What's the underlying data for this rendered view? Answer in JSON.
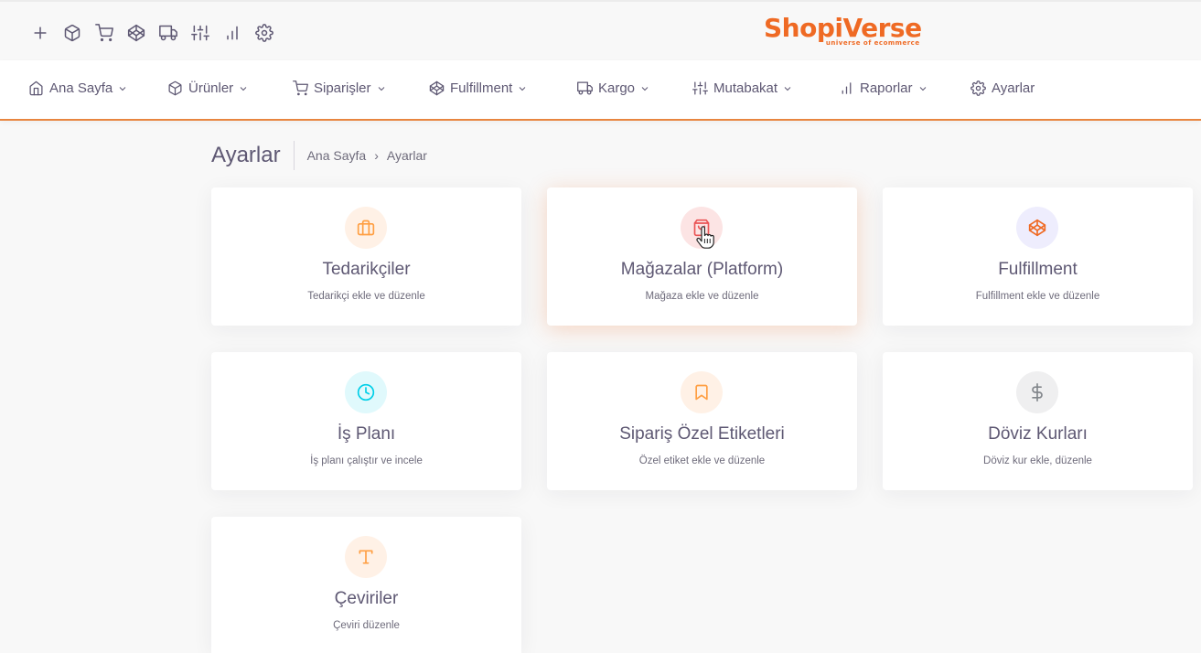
{
  "brand": {
    "name": "ShopiVerse",
    "tagline": "universe of ecommerce",
    "color": "#ef6a24"
  },
  "top_icons": [
    "plus-icon",
    "box-icon",
    "cart-icon",
    "codepen-icon",
    "truck-icon",
    "sliders-icon",
    "bar-chart-icon",
    "gear-icon"
  ],
  "nav": {
    "items": [
      {
        "label": "Ana Sayfa",
        "icon": "home-icon",
        "dropdown": true
      },
      {
        "label": "Ürünler",
        "icon": "box-icon",
        "dropdown": true
      },
      {
        "label": "Siparişler",
        "icon": "cart-icon",
        "dropdown": true
      },
      {
        "label": "Fulfillment",
        "icon": "codepen-icon",
        "dropdown": true
      },
      {
        "label": "Kargo",
        "icon": "truck-icon",
        "dropdown": true
      },
      {
        "label": "Mutabakat",
        "icon": "sliders-icon",
        "dropdown": true
      },
      {
        "label": "Raporlar",
        "icon": "bar-chart-icon",
        "dropdown": true
      },
      {
        "label": "Ayarlar",
        "icon": "gear-icon",
        "dropdown": false
      }
    ]
  },
  "page": {
    "title": "Ayarlar",
    "breadcrumb": {
      "home": "Ana Sayfa",
      "current": "Ayarlar"
    }
  },
  "cards": [
    {
      "title": "Tedarikçiler",
      "subtitle": "Tedarikçi ekle ve düzenle",
      "icon": "briefcase-icon",
      "color": "#ff9f43"
    },
    {
      "title": "Mağazalar (Platform)",
      "subtitle": "Mağaza ekle ve düzenle",
      "icon": "shopping-bag-icon",
      "color": "#ea5455",
      "active": true
    },
    {
      "title": "Fulfillment",
      "subtitle": "Fulfillment ekle ve düzenle",
      "icon": "codepen-icon",
      "color": "#7367f0"
    },
    {
      "title": "İş Planı",
      "subtitle": "İş planı çalıştır ve incele",
      "icon": "clock-icon",
      "color": "#00cfe8"
    },
    {
      "title": "Sipariş Özel Etiketleri",
      "subtitle": "Özel etiket ekle ve düzenle",
      "icon": "bookmark-icon",
      "color": "#ff9f43"
    },
    {
      "title": "Döviz Kurları",
      "subtitle": "Döviz kur ekle, düzenle",
      "icon": "dollar-sign-icon",
      "color": "#82868b"
    },
    {
      "title": "Çeviriler",
      "subtitle": "Çeviri düzenle",
      "icon": "type-icon",
      "color": "#ff9f43"
    }
  ]
}
